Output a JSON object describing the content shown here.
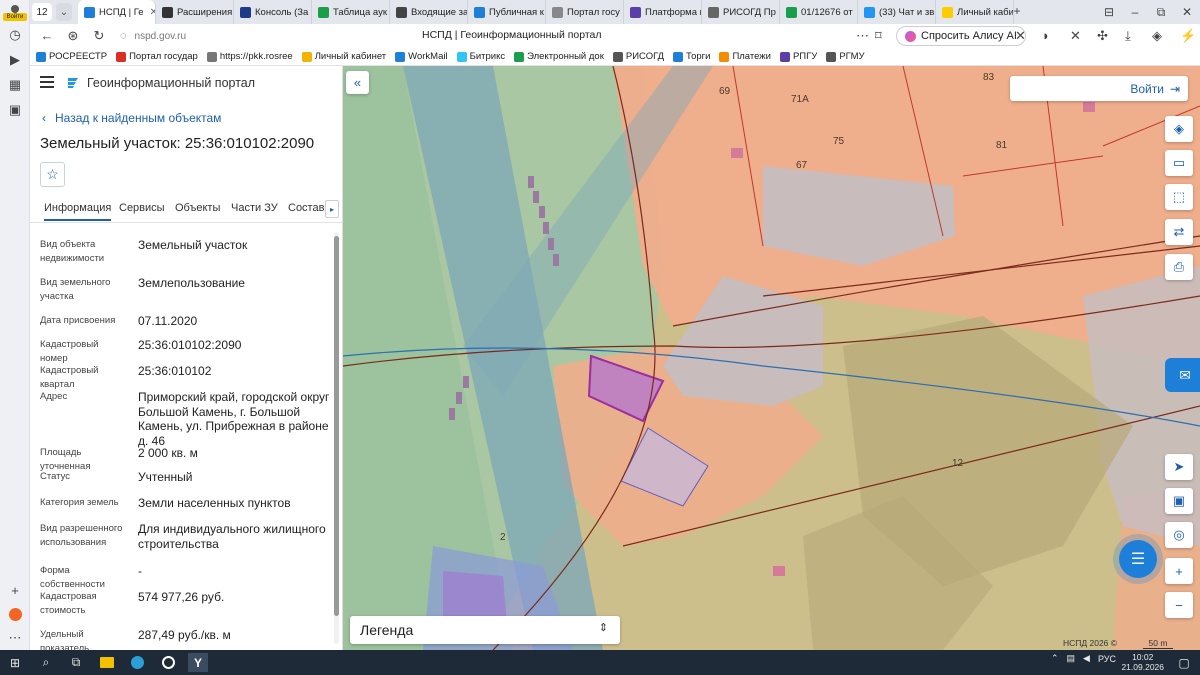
{
  "browser": {
    "profile_label": "Войти",
    "tab_count": "12",
    "tabs": [
      {
        "label": "НСПД | Ге",
        "icon": "#1e7fd8",
        "active": true
      },
      {
        "label": "Расширения",
        "icon": "#333"
      },
      {
        "label": "Консоль (За",
        "icon": "#1e3a8a"
      },
      {
        "label": "Таблица аук",
        "icon": "#1a9e4b"
      },
      {
        "label": "Входящие за",
        "icon": "#444"
      },
      {
        "label": "Публичная к",
        "icon": "#1e7fd8"
      },
      {
        "label": "Портал госу",
        "icon": "#888"
      },
      {
        "label": "Платформа г",
        "icon": "#5a3fa8"
      },
      {
        "label": "РИСОГД Пр",
        "icon": "#666"
      },
      {
        "label": "01/12676 от",
        "icon": "#1a9e4b"
      },
      {
        "label": "(33) Чат и зв",
        "icon": "#2196f3"
      },
      {
        "label": "Личный каби",
        "icon": "#ffcc00"
      }
    ],
    "url": "nspd.gov.ru",
    "page_title": "НСПД | Геоинформационный портал",
    "alisa_label": "Спросить Алису AI",
    "bookmarks": [
      {
        "label": "РОСРЕЕСТР",
        "color": "#1e7fd8"
      },
      {
        "label": "Портал государ",
        "color": "#d93025"
      },
      {
        "label": "https://pkk.rosree",
        "color": "#777"
      },
      {
        "label": "Личный кабинет",
        "color": "#f2b400"
      },
      {
        "label": "WorkMail",
        "color": "#1e7fd8"
      },
      {
        "label": "Битрикс",
        "color": "#2fc6f6"
      },
      {
        "label": "Электронный док",
        "color": "#1a9e4b"
      },
      {
        "label": "РИСОГД",
        "color": "#555"
      },
      {
        "label": "Торги",
        "color": "#1e7fd8"
      },
      {
        "label": "Платежи",
        "color": "#f28c00"
      },
      {
        "label": "РПГУ",
        "color": "#5a3fa8"
      },
      {
        "label": "РГМУ",
        "color": "#555"
      }
    ]
  },
  "panel": {
    "portal_name": "Геоинформационный портал",
    "back_label": "Назад к найденным объектам",
    "object_title": "Земельный участок: 25:36:010102:2090",
    "tabs": [
      "Информация",
      "Сервисы",
      "Объекты",
      "Части ЗУ",
      "Состав"
    ],
    "attributes": [
      {
        "label": "Вид объекта недвижимости",
        "value": "Земельный участок"
      },
      {
        "label": "Вид земельного участка",
        "value": "Землепользование"
      },
      {
        "label": "Дата присвоения",
        "value": "07.11.2020"
      },
      {
        "label": "Кадастровый номер",
        "value": "25:36:010102:2090"
      },
      {
        "label": "Кадастровый квартал",
        "value": "25:36:010102"
      },
      {
        "label": "Адрес",
        "value": "Приморский край, городской округ Большой Камень, г. Большой Камень, ул. Прибрежная в районе д. 46"
      },
      {
        "label": "Площадь уточненная",
        "value": "2 000 кв. м"
      },
      {
        "label": "Статус",
        "value": "Учтенный"
      },
      {
        "label": "Категория земель",
        "value": "Земли населенных пунктов"
      },
      {
        "label": "Вид разрешенного использования",
        "value": "Для индивидуального жилищного строительства"
      },
      {
        "label": "Форма собственности",
        "value": "-"
      },
      {
        "label": "Кадастровая стоимость",
        "value": "574 977,26 руб."
      },
      {
        "label": "Удельный показатель кадастровой",
        "value": "287,49 руб./кв. м"
      }
    ]
  },
  "map": {
    "login_label": "Войти",
    "legend_label": "Легенда",
    "copyright": "НСПД 2026 ©",
    "scale_label": "50 m",
    "parcel_labels": [
      "83",
      "69",
      "71А",
      "75",
      "81",
      "67",
      "12",
      "2"
    ]
  },
  "taskbar": {
    "language": "РУС",
    "time": "10:02",
    "date": "21.09.2026"
  }
}
